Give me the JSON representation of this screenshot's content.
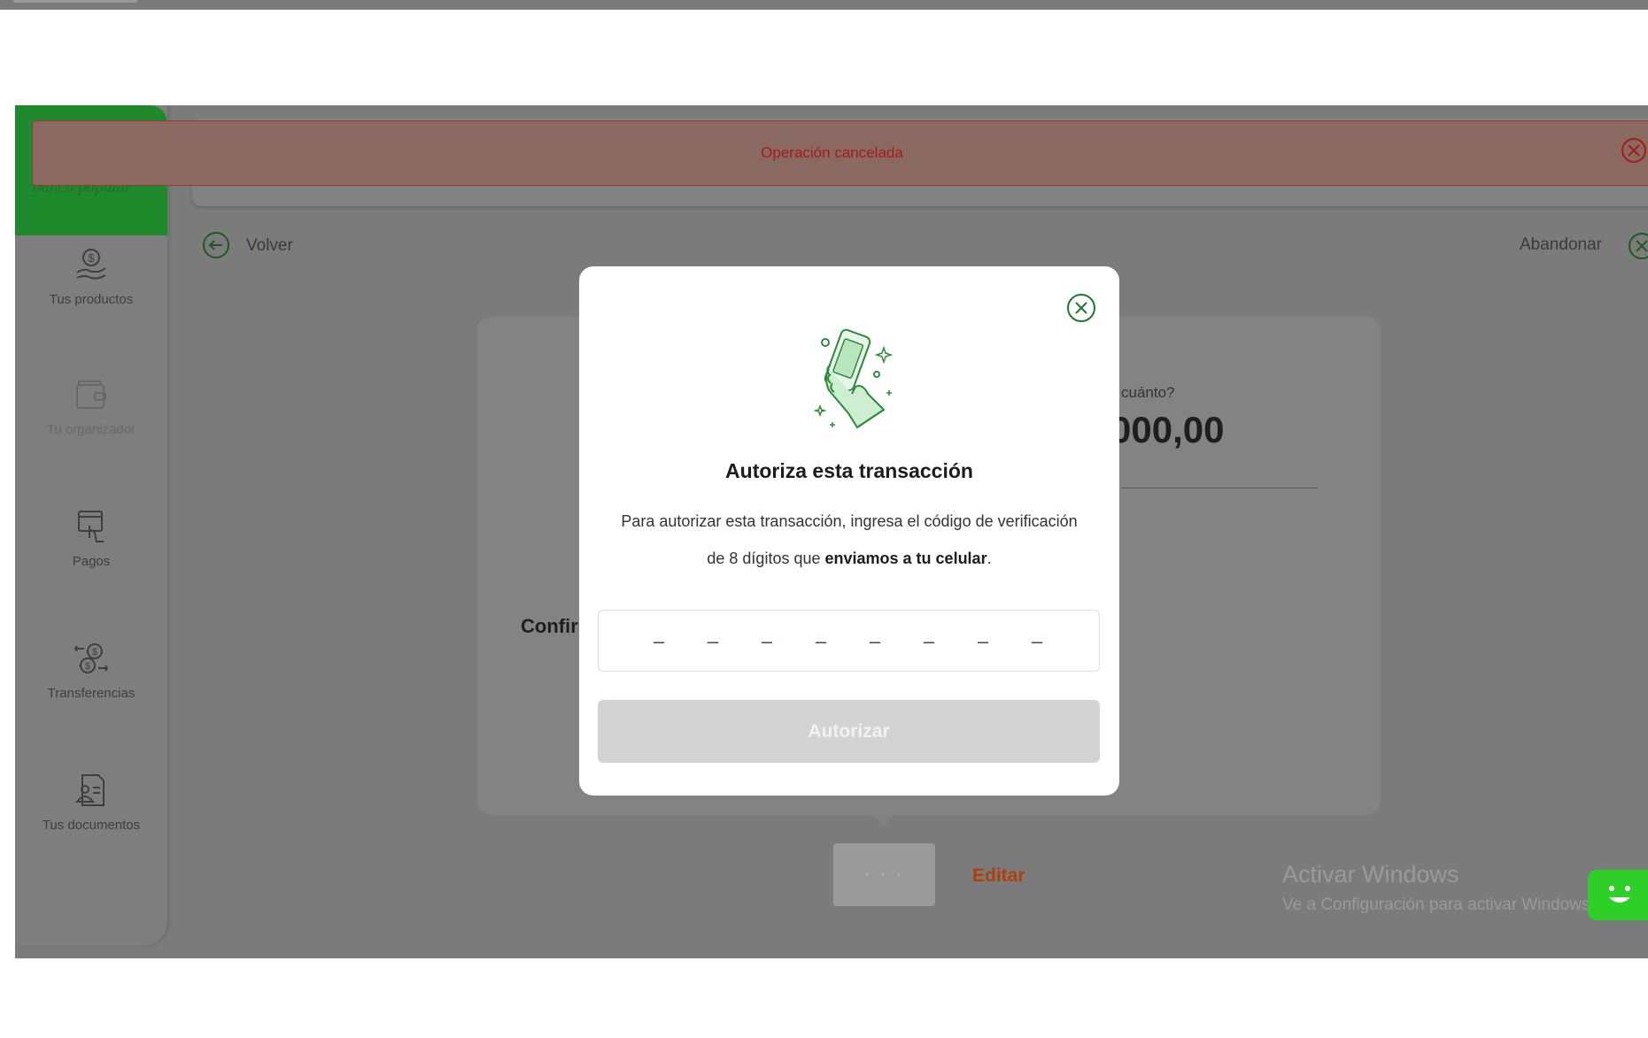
{
  "alert": {
    "message": "Operación cancelada",
    "close_icon": "close-circle-icon"
  },
  "brand": {
    "name": "banco popular"
  },
  "sidebar": {
    "items": [
      {
        "label": "Tus productos",
        "icon": "money-hand-icon"
      },
      {
        "label": "Tu organizador",
        "icon": "wallet-icon"
      },
      {
        "label": "Pagos",
        "icon": "payment-touch-icon"
      },
      {
        "label": "Transferencias",
        "icon": "transfer-icon"
      },
      {
        "label": "Tus documentos",
        "icon": "documents-icon"
      }
    ]
  },
  "nav": {
    "back_label": "Volver",
    "abandon_label": "Abandonar"
  },
  "background_card": {
    "question_partial": "cuánto?",
    "amount_partial": "000,00",
    "confirm_partial": "Confir"
  },
  "footer": {
    "more_label": "· · ·",
    "edit_label": "Editar"
  },
  "windows_watermark": {
    "title": "Activar Windows",
    "subtitle": "Ve a Configuración para activar Windows."
  },
  "modal": {
    "title": "Autoriza esta transacción",
    "desc_line1": "Para autorizar esta transacción, ingresa el código de verificación",
    "desc_line2_prefix": "de 8 dígitos que ",
    "desc_line2_bold": "enviamos a tu celular",
    "desc_line2_suffix": ".",
    "code_placeholder": [
      "–",
      "–",
      "–",
      "–",
      "–",
      "–",
      "–",
      "–"
    ],
    "authorize_label": "Autorizar"
  },
  "colors": {
    "brand_green": "#1f8a2c",
    "alert_red": "#a51c10",
    "edit_orange": "#b0400a",
    "disabled_button": "#d3d3d3",
    "bot_green": "#2fcf2a"
  }
}
